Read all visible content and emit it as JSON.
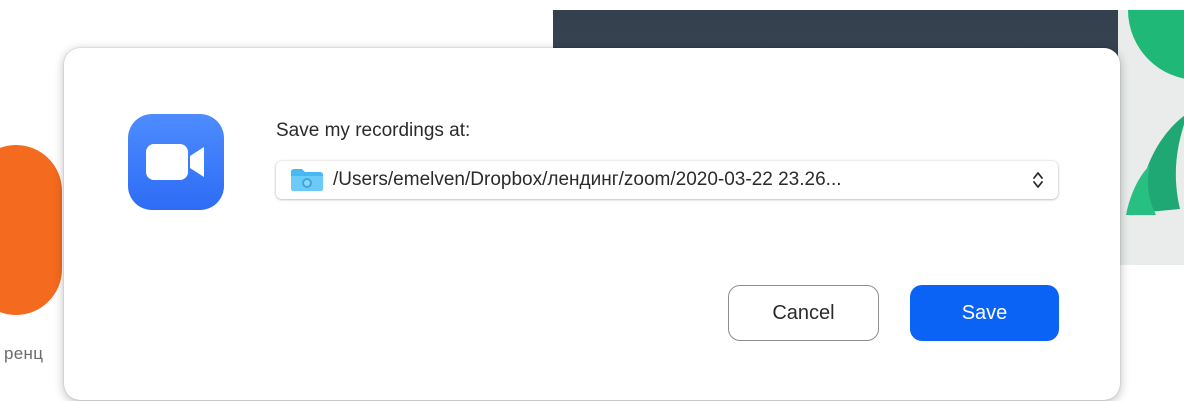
{
  "background": {
    "partial_text": "ренц"
  },
  "dialog": {
    "app_icon": "zoom-video-camera-icon",
    "prompt": "Save my recordings at:",
    "path_popup": {
      "value": "/Users/emelven/Dropbox/лендинг/zoom/2020-03-22 23.26...",
      "folder_icon": "folder-icon",
      "stepper_icon": "chevron-up-down-icon"
    },
    "buttons": {
      "cancel": "Cancel",
      "save": "Save"
    }
  },
  "colors": {
    "accent": "#0b63f6",
    "app_icon": "#2d6cf5",
    "folder": "#5cc4f5"
  }
}
